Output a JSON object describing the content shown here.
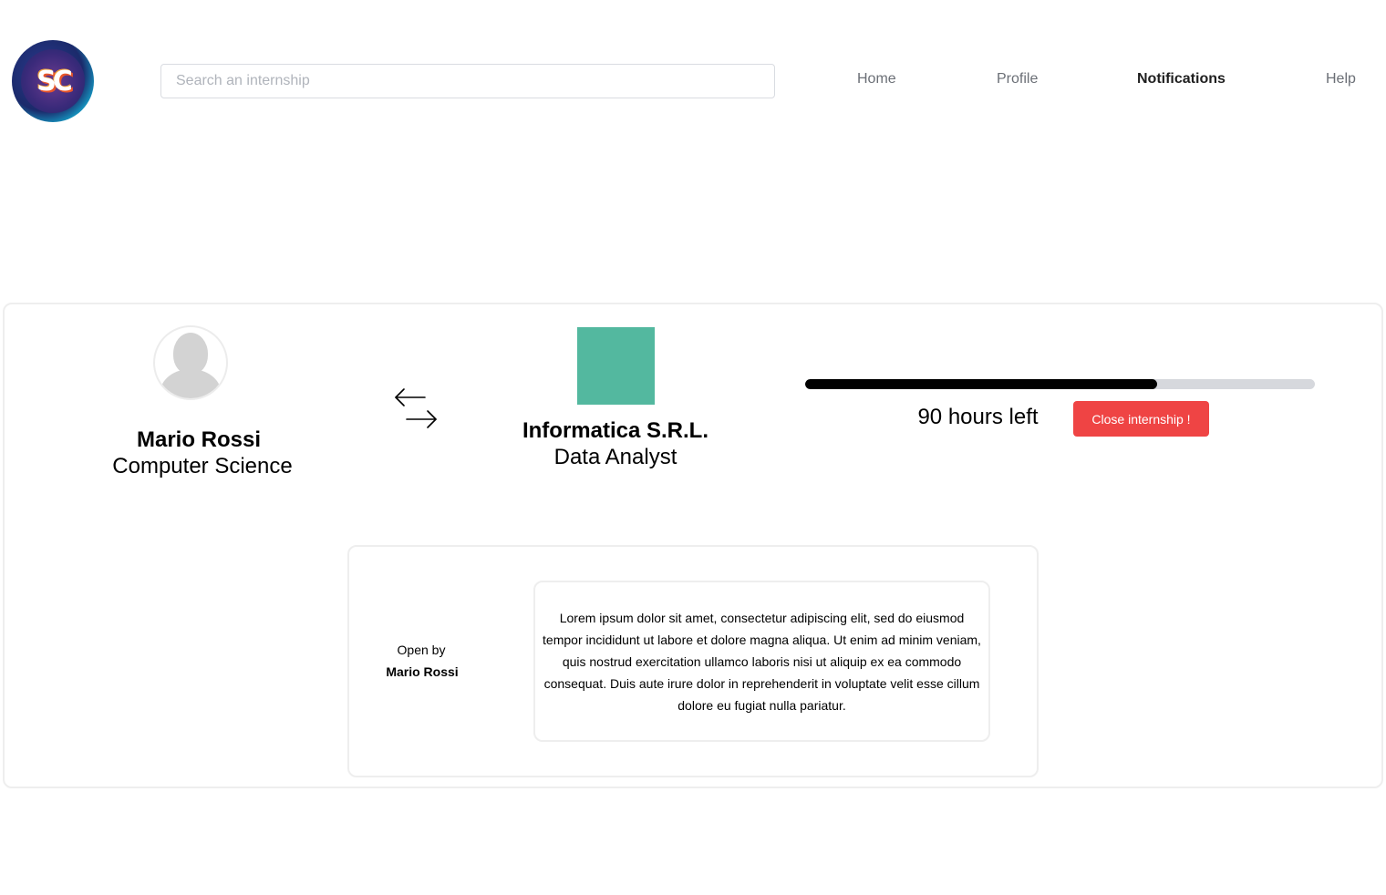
{
  "header": {
    "logo_text": "SC",
    "search_placeholder": "Search an internship",
    "nav": {
      "home": "Home",
      "profile": "Profile",
      "notifications": "Notifications",
      "help": "Help"
    },
    "active_nav": "notifications"
  },
  "student": {
    "name": "Mario Rossi",
    "course": "Computer Science"
  },
  "company": {
    "name": "Informatica S.R.L.",
    "role": "Data Analyst",
    "logo_color": "#53b89f"
  },
  "progress": {
    "fraction_complete": 0.69,
    "hours_left_text": "90 hours left"
  },
  "actions": {
    "close_internship_label": "Close internship !"
  },
  "message": {
    "open_by_label": "Open by",
    "open_by_name": "Mario Rossi",
    "body": "Lorem ipsum dolor sit amet, consectetur adipiscing elit, sed do eiusmod tempor incididunt ut labore et dolore magna aliqua. Ut enim ad minim veniam, quis nostrud exercitation ullamco laboris nisi ut aliquip ex ea commodo consequat. Duis aute irure dolor in reprehenderit in voluptate velit esse cillum dolore eu fugiat nulla pariatur."
  },
  "colors": {
    "danger": "#ef4444",
    "progress_fill": "#000000",
    "progress_track": "#d6d8dd"
  },
  "icons": {
    "swap": "swap-arrows-icon",
    "avatar": "user-placeholder-icon"
  }
}
